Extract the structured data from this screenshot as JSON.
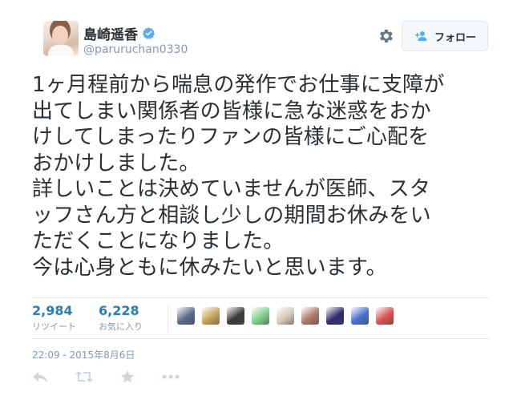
{
  "user": {
    "name": "島崎遥香",
    "handle": "@paruruchan0330"
  },
  "follow_button": {
    "label": "フォロー"
  },
  "tweet": {
    "text": "1ヶ月程前から喘息の発作でお仕事に支障が\n出てしまい関係者の皆様に急な迷惑をおか\nけしてしまったりファンの皆様にご心配を\nおかけしました。\n詳しいことは決めていませんが医師、スタ\nッフさん方と相談し少しの期間お休みをい\nただくことになりました。\n今は心身ともに休みたいと思います。",
    "timestamp": "22:09 - 2015年8月6日"
  },
  "stats": {
    "retweets": {
      "count": "2,984",
      "label": "リツイート"
    },
    "likes": {
      "count": "6,228",
      "label": "お気に入り"
    }
  },
  "likers": [
    {
      "icon": "liker-avatar-1",
      "color": "#5a6b8c"
    },
    {
      "icon": "liker-avatar-2",
      "color": "#c9a45a"
    },
    {
      "icon": "liker-avatar-3",
      "color": "#3a3a3a"
    },
    {
      "icon": "liker-avatar-4",
      "color": "#7fcf8a"
    },
    {
      "icon": "liker-avatar-5",
      "color": "#d8c9b8"
    },
    {
      "icon": "liker-avatar-6",
      "color": "#b07a6a"
    },
    {
      "icon": "liker-avatar-7",
      "color": "#2e2a6e"
    },
    {
      "icon": "liker-avatar-8",
      "color": "#4b6fd1"
    },
    {
      "icon": "liker-avatar-9",
      "color": "#d9534f"
    }
  ],
  "icons": {
    "verified": "verified-badge-icon",
    "settings": "gear-icon",
    "follow": "add-user-icon",
    "reply": "reply-icon",
    "retweet": "retweet-icon",
    "favorite": "star-icon",
    "more": "more-icon"
  },
  "colors": {
    "accent": "#2b7bb9",
    "verified": "#55acee",
    "muted": "#8899a6",
    "action_icon": "#ccd6dd"
  }
}
